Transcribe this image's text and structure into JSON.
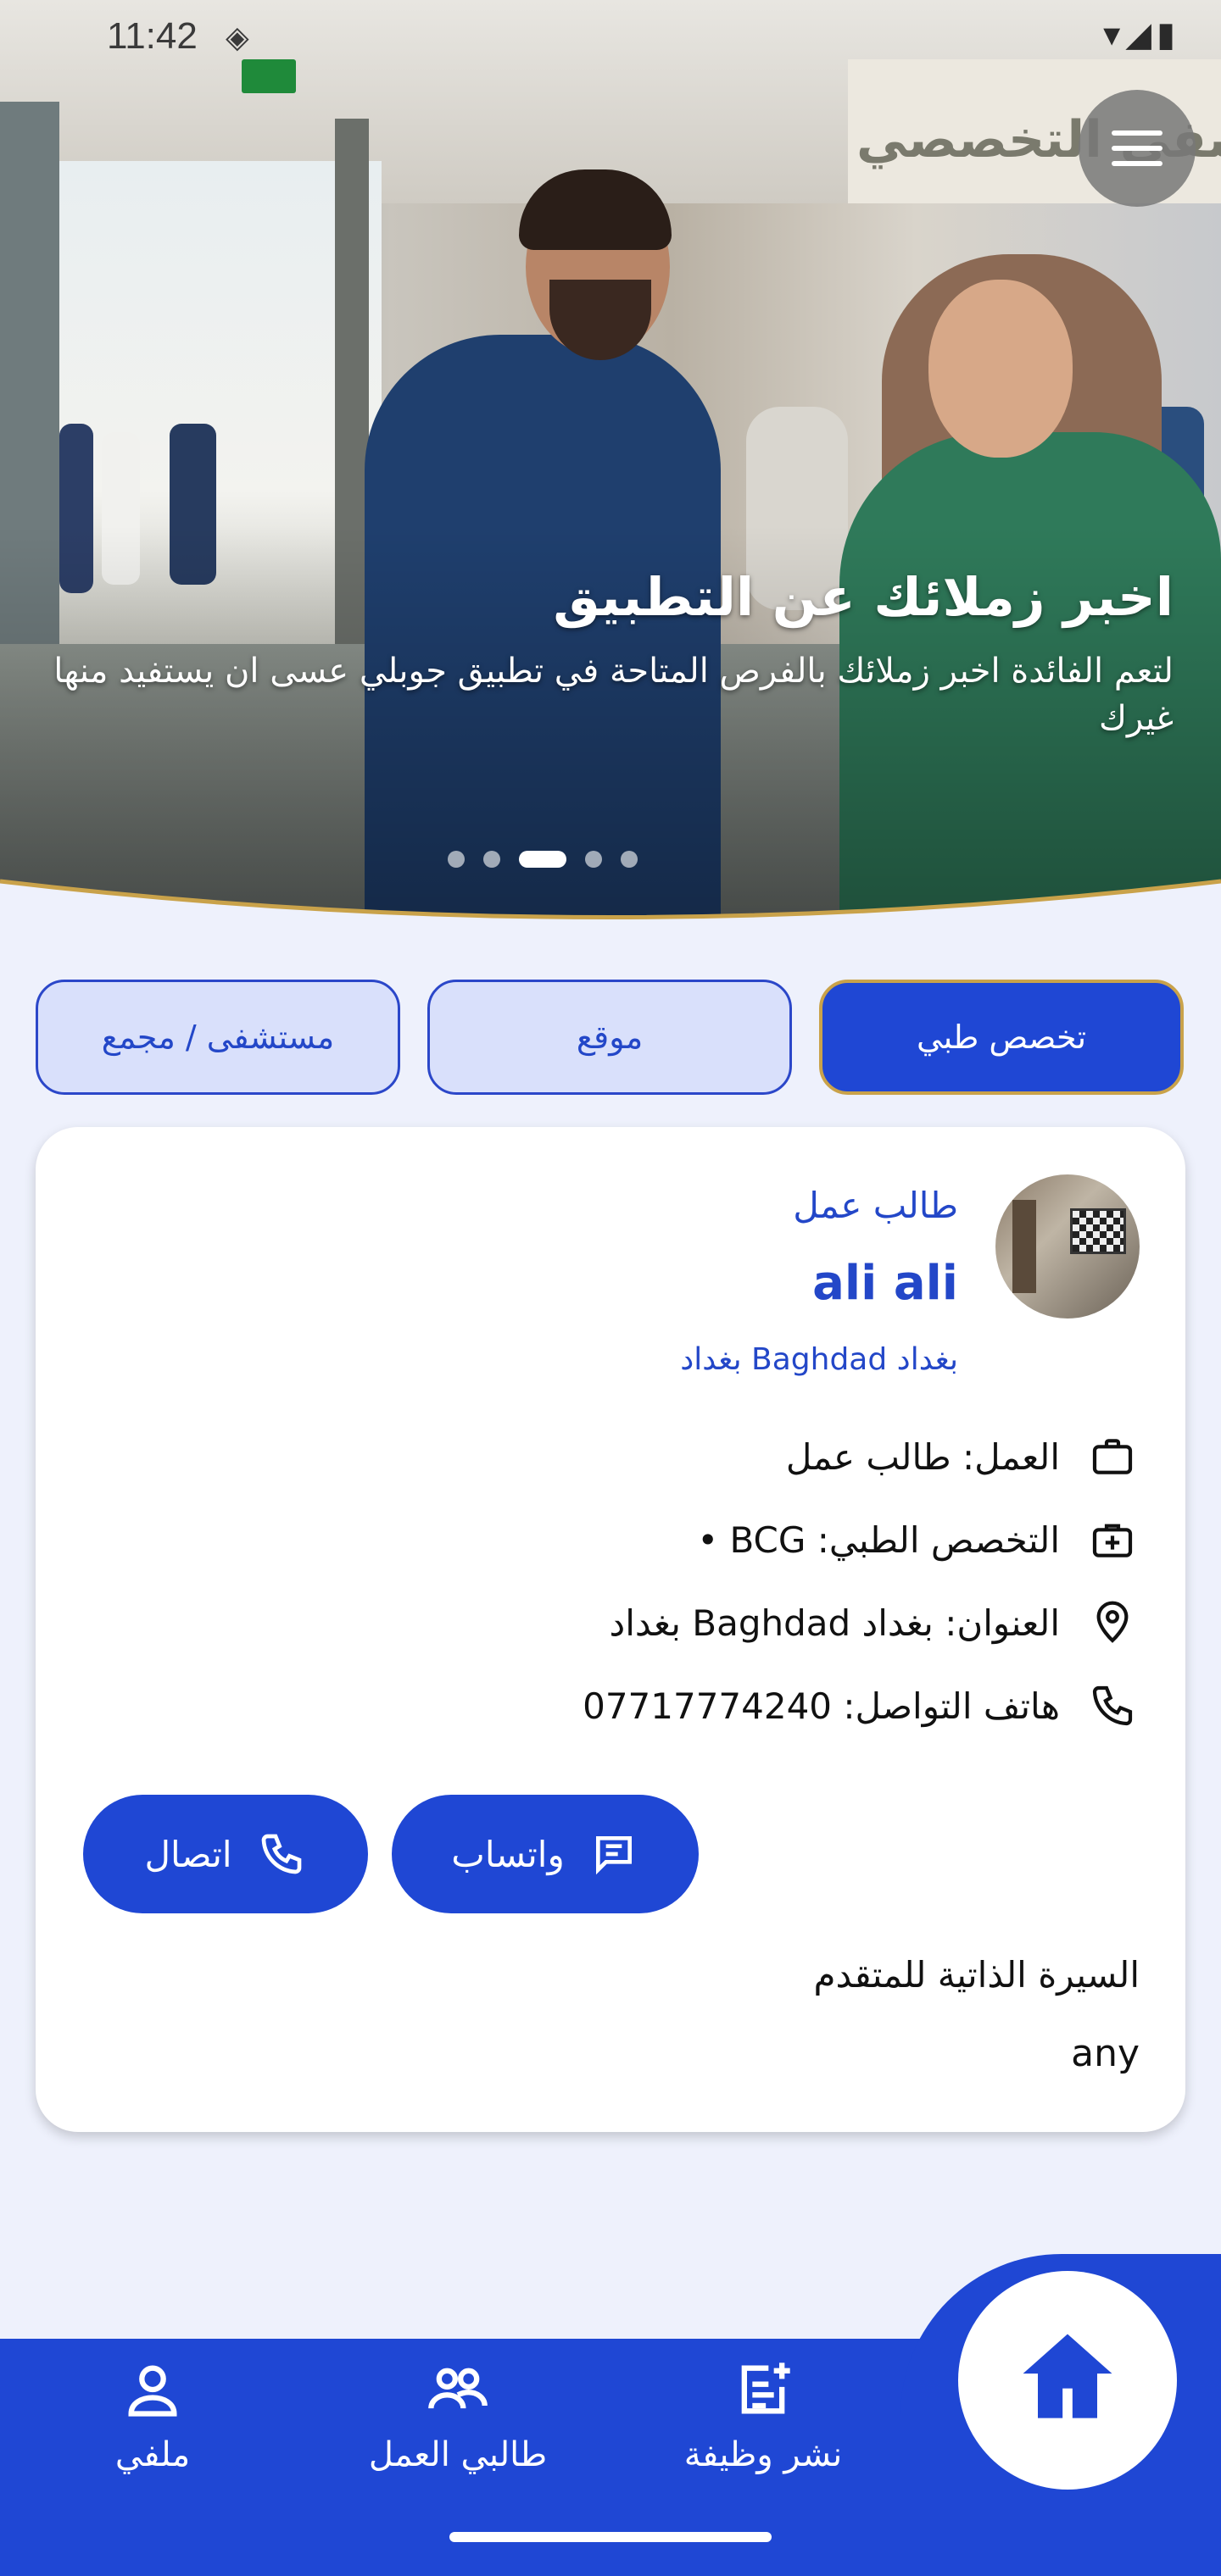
{
  "status_bar": {
    "time": "11:42"
  },
  "hero": {
    "sign_text": "شفى التخصصي",
    "title": "اخبر زملائك عن التطبيق",
    "subtitle": "لتعم الفائدة اخبر زملائك بالفرص المتاحة في تطبيق جوبلي عسى ان يستفيد منها غيرك",
    "slide_count": 5,
    "active_slide": 3
  },
  "filters": [
    {
      "label": "تخصص طبي",
      "active": true
    },
    {
      "label": "موقع",
      "active": false
    },
    {
      "label": "مستشفى / مجمع",
      "active": false
    }
  ],
  "card": {
    "role": "طالب عمل",
    "name": "ali ali",
    "location": "بغداد Baghdad بغداد",
    "rows": {
      "job": "العمل: طالب عمل",
      "specialty": "التخصص الطبي: BCG •",
      "address": "العنوان: بغداد Baghdad بغداد",
      "phone": "هاتف التواصل: 07717774240"
    },
    "whatsapp_label": "واتساب",
    "call_label": "اتصال",
    "cv_label": "السيرة الذاتية للمتقدم",
    "cv_value": "any"
  },
  "bottom_nav": {
    "post_job": "نشر وظيفة",
    "job_seekers": "طالبي العمل",
    "profile": "ملفي"
  },
  "colors": {
    "primary": "#1f47d4",
    "accent_gold": "#c9a24a",
    "background": "#eef1fc"
  },
  "icons": [
    "menu-icon",
    "briefcase-icon",
    "medical-bag-icon",
    "location-pin-icon",
    "phone-icon",
    "message-icon",
    "home-icon",
    "post-add-icon",
    "group-icon",
    "person-icon"
  ]
}
